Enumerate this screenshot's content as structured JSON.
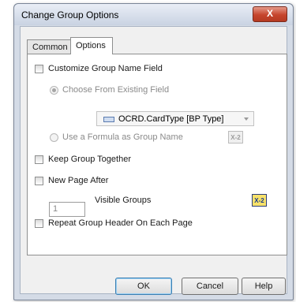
{
  "window": {
    "title": "Change Group Options",
    "close_label": "X"
  },
  "tabs": [
    {
      "label": "Common"
    },
    {
      "label": "Options"
    }
  ],
  "options": {
    "customize_group_name": {
      "label": "Customize Group Name Field",
      "checked": false
    },
    "choose_from_existing": {
      "label": "Choose From Existing Field",
      "selected": true
    },
    "field_dropdown": {
      "value": "OCRD.CardType [BP Type]"
    },
    "use_formula": {
      "label": "Use a Formula as Group Name",
      "selected": false
    },
    "formula_button_label": "X-2",
    "keep_together": {
      "label": "Keep Group Together",
      "checked": false
    },
    "new_page_after": {
      "label": "New Page After",
      "checked": false
    },
    "visible_groups_value": "1",
    "visible_groups_label": "Visible Groups",
    "repeat_header": {
      "label": "Repeat Group Header On Each Page",
      "checked": false
    }
  },
  "buttons": {
    "ok": "OK",
    "cancel": "Cancel",
    "help": "Help"
  }
}
